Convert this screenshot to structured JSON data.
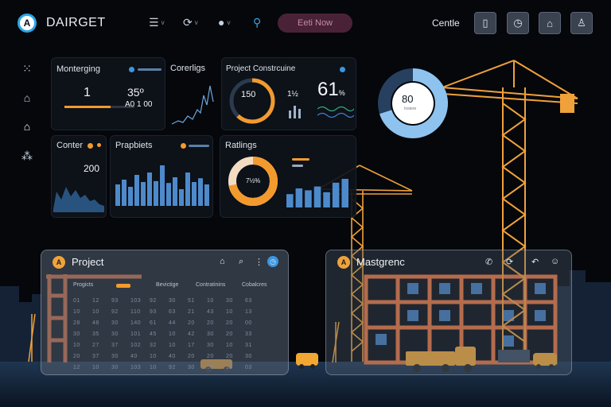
{
  "header": {
    "logo_letter": "A",
    "brand": "DAIRGET",
    "controls": [
      {
        "icon": "list-icon",
        "caret": "v"
      },
      {
        "icon": "refresh-icon",
        "caret": "v"
      },
      {
        "icon": "apple-icon",
        "caret": "v"
      },
      {
        "icon": "location-pin-icon",
        "caret": ""
      }
    ],
    "new_button": "Eeti Now",
    "right_label": "Centle",
    "icon_buttons": [
      "document-icon",
      "clock-icon",
      "home-icon",
      "user-icon"
    ]
  },
  "sidebar": {
    "items": [
      "grid-icon",
      "building-icon",
      "home-icon",
      "share-icon"
    ]
  },
  "widgets": {
    "monitoring": {
      "title": "Monterging",
      "value": "1"
    },
    "center_stats": {
      "value_top": "35º",
      "value_bottom": "A0 1 00"
    },
    "controls": {
      "title": "Corerligs"
    },
    "project": {
      "title": "Project Constrcuine",
      "gauge_value": "150",
      "mid_value": "1½",
      "percent": "61",
      "percent_unit": "%",
      "gauge_progress": 0.62
    },
    "counter": {
      "title": "Conter",
      "value": "200"
    },
    "progress": {
      "title": "Prapbiets",
      "bars": [
        0.45,
        0.55,
        0.4,
        0.65,
        0.5,
        0.7,
        0.52,
        0.85,
        0.48,
        0.6,
        0.35,
        0.7,
        0.5,
        0.58,
        0.45
      ]
    },
    "ratings": {
      "title": "Ratlings",
      "donut_value": "7½%",
      "donut_progress": 0.72,
      "bars": [
        0.35,
        0.5,
        0.45,
        0.55,
        0.4,
        0.65,
        0.75
      ]
    },
    "ring": {
      "value": "80",
      "sub": "Instere",
      "progress": 0.7
    }
  },
  "colors": {
    "accent": "#f39a2e",
    "blue": "#5b93cf",
    "crane": "#f0a13a",
    "steel": "#e8723a"
  },
  "panels": {
    "project": {
      "logo": "A",
      "title": "Project",
      "icons": [
        "home-icon",
        "search-icon",
        "more-icon",
        "clock-icon"
      ],
      "columns": [
        "Progicts",
        "",
        "Bevictige",
        "Contratinins",
        "Cobalcres"
      ],
      "rows": [
        [
          "01",
          "12",
          "93",
          "103",
          "92",
          "30",
          "51",
          "10",
          "30",
          "63"
        ],
        [
          "10",
          "10",
          "92",
          "110",
          "93",
          "63",
          "21",
          "43",
          "10",
          "13"
        ],
        [
          "28",
          "48",
          "30",
          "140",
          "61",
          "44",
          "20",
          "20",
          "20",
          "00"
        ],
        [
          "30",
          "35",
          "30",
          "101",
          "45",
          "10",
          "42",
          "30",
          "20",
          "33"
        ],
        [
          "10",
          "27",
          "37",
          "102",
          "32",
          "10",
          "17",
          "30",
          "10",
          "31"
        ],
        [
          "20",
          "37",
          "30",
          "40",
          "10",
          "40",
          "20",
          "20",
          "20",
          "30"
        ],
        [
          "12",
          "10",
          "30",
          "103",
          "10",
          "92",
          "30",
          "50",
          "29",
          "03"
        ]
      ]
    },
    "management": {
      "logo": "A",
      "title": "Mastgrenc",
      "icons": [
        "phone-icon",
        "refresh-icon",
        "back-icon",
        "smile-icon"
      ]
    }
  }
}
